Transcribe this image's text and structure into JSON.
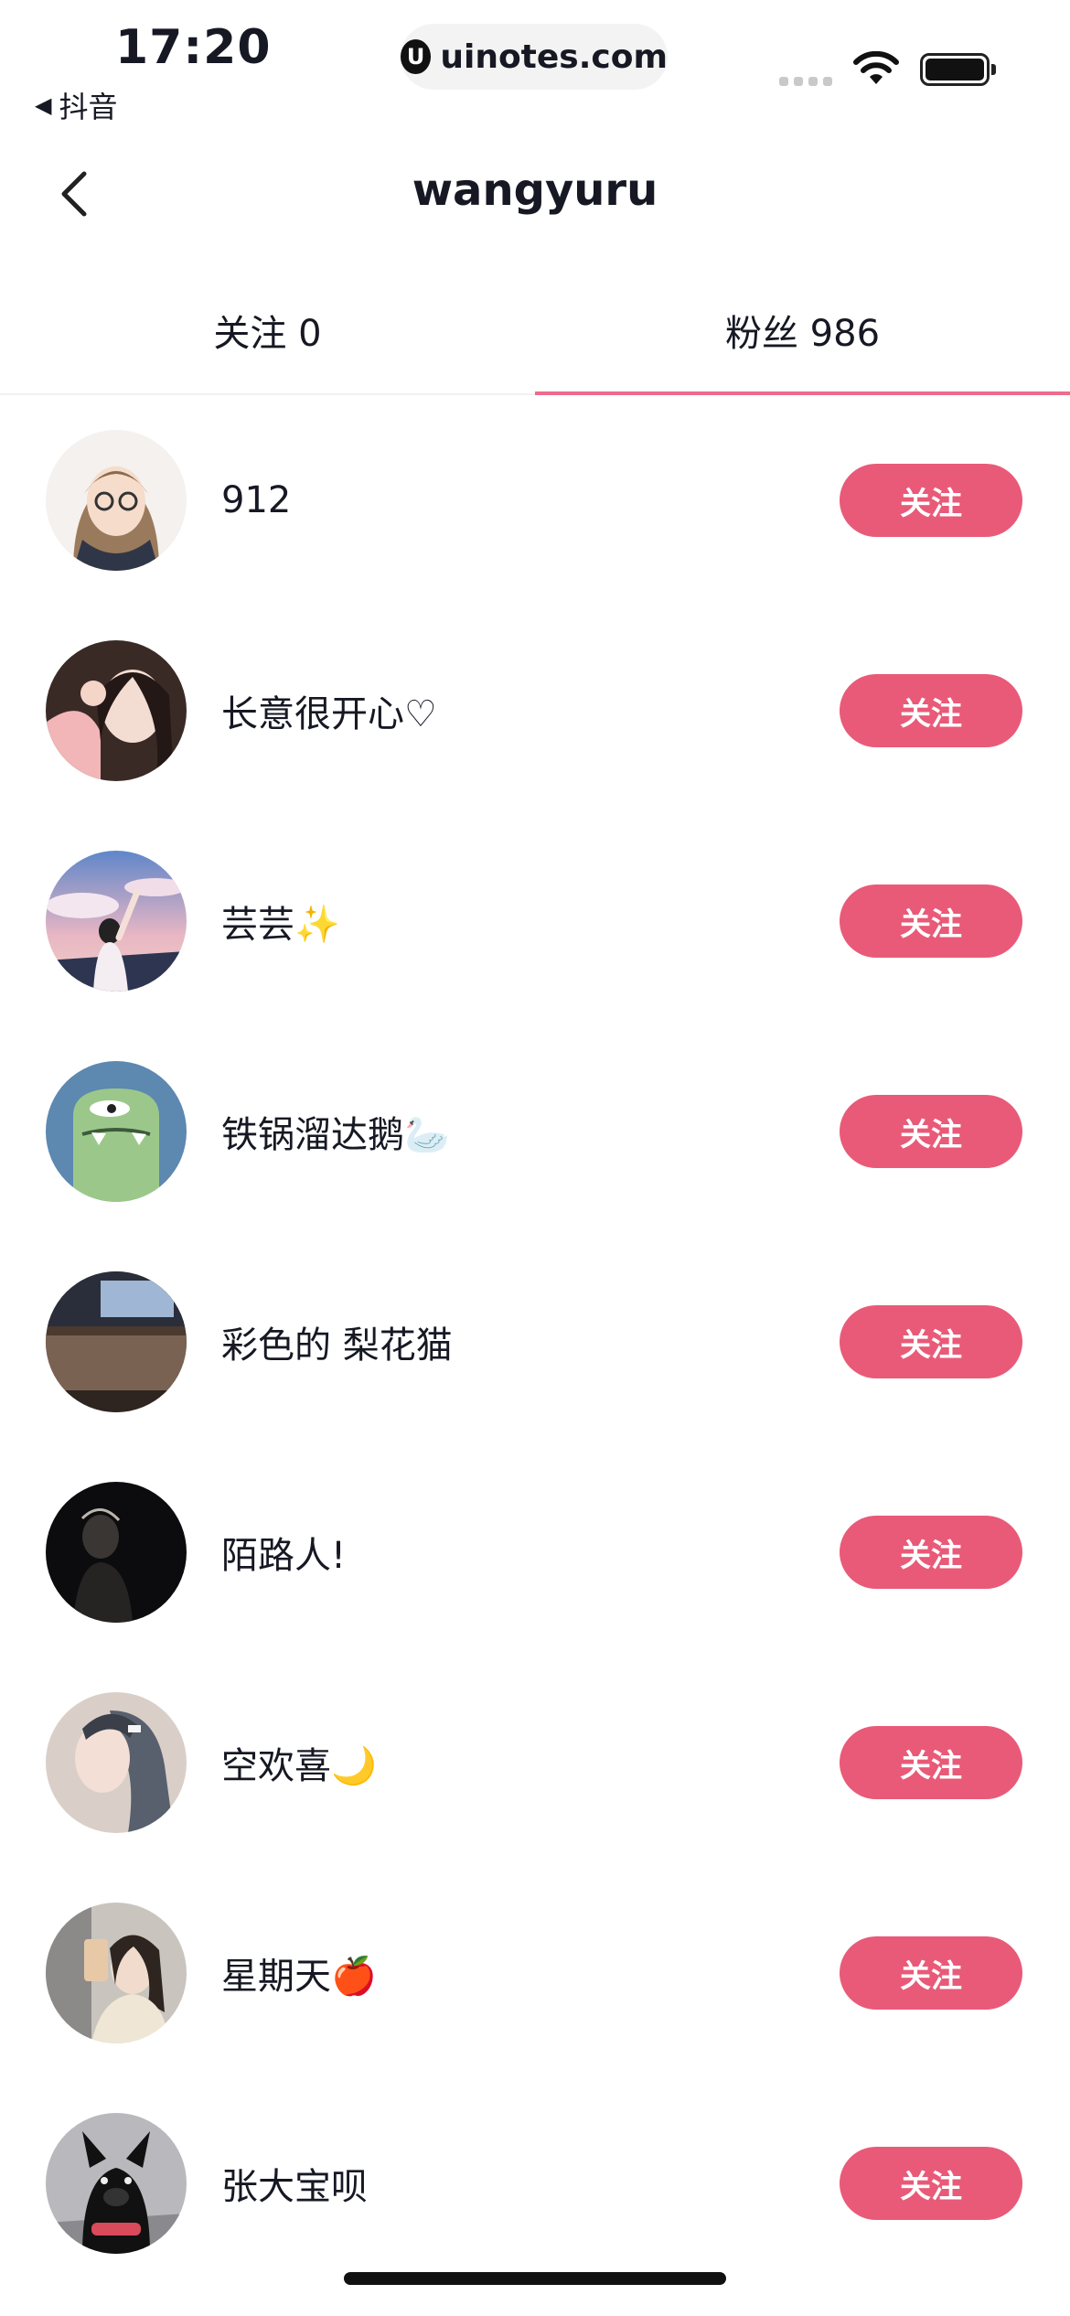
{
  "status_bar": {
    "time": "17:20",
    "back_app": "抖音",
    "url": "uinotes.com",
    "url_logo": "U"
  },
  "nav": {
    "title": "wangyuru"
  },
  "tabs": [
    {
      "label": "关注 0",
      "selected": false
    },
    {
      "label": "粉丝 986",
      "selected": true
    }
  ],
  "accent_color": "#e95a78",
  "followers": [
    {
      "name": "912",
      "button": "关注",
      "avatar": "illustrated-girl-avatar"
    },
    {
      "name": "长意很开心♡",
      "button": "关注",
      "avatar": "selfie-girl-avatar"
    },
    {
      "name": "芸芸✨",
      "button": "关注",
      "avatar": "sky-girl-avatar"
    },
    {
      "name": "铁锅溜达鹅🦢",
      "button": "关注",
      "avatar": "green-monster-avatar"
    },
    {
      "name": "彩色的 梨花猫",
      "button": "关注",
      "avatar": "living-room-avatar"
    },
    {
      "name": "陌路人!",
      "button": "关注",
      "avatar": "dark-silhouette-avatar"
    },
    {
      "name": "空欢喜🌙",
      "button": "关注",
      "avatar": "grey-hair-girl-avatar"
    },
    {
      "name": "星期天🍎",
      "button": "关注",
      "avatar": "mirror-selfie-avatar"
    },
    {
      "name": "张大宝呗",
      "button": "关注",
      "avatar": "black-dog-avatar"
    }
  ]
}
